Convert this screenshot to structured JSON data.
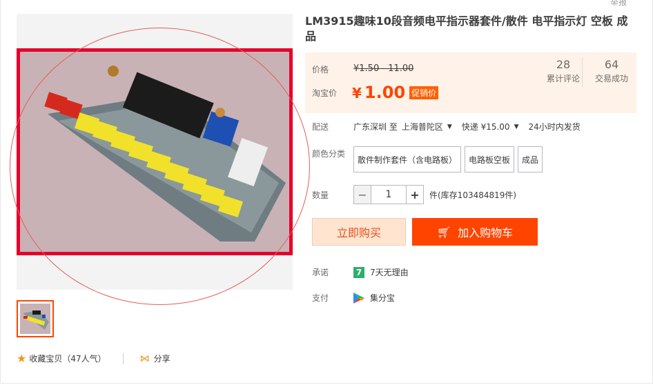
{
  "header": {
    "report_label": "举报"
  },
  "product": {
    "title": "LM3915趣味10段音频电平指示器套件/散件 电平指示灯 空板 成品"
  },
  "price": {
    "price_label": "价格",
    "original_price": "¥1.50 - 11.00",
    "taobao_label": "淘宝价",
    "currency": "¥",
    "current_price": "1.00",
    "promo_tag": "促销价"
  },
  "stats": {
    "reviews_count": "28",
    "reviews_label": "累计评论",
    "sold_count": "64",
    "sold_label": "交易成功"
  },
  "delivery": {
    "label": "配送",
    "from": "广东深圳 至",
    "to": "上海普陀区",
    "method": "快递 ¥15.00",
    "dispatch": "24小时内发货"
  },
  "sku": {
    "label": "颜色分类",
    "options": [
      "散件制作套件（含电路板）",
      "电路板空板",
      "成品"
    ]
  },
  "quantity": {
    "label": "数量",
    "minus": "−",
    "value": "1",
    "plus": "+",
    "stock": "件(库存103484819件)"
  },
  "actions": {
    "buy_now": "立即购买",
    "add_cart": "加入购物车"
  },
  "promise": {
    "label": "承诺",
    "icon_text": "7",
    "text": "7天无理由"
  },
  "payment": {
    "label": "支付",
    "text": "集分宝"
  },
  "social": {
    "favorite": "收藏宝贝（47人气）",
    "share": "分享"
  },
  "colors": {
    "accent": "#ff4400",
    "highlight_border": "#e4002b",
    "price_panel_bg": "#fff2e8"
  },
  "icons": {
    "star": "star-icon",
    "share": "share-icon",
    "cart": "cart-icon",
    "seven_day": "seven-day-icon",
    "payment": "jifenbao-icon",
    "dropdown": "chevron-down-icon"
  }
}
